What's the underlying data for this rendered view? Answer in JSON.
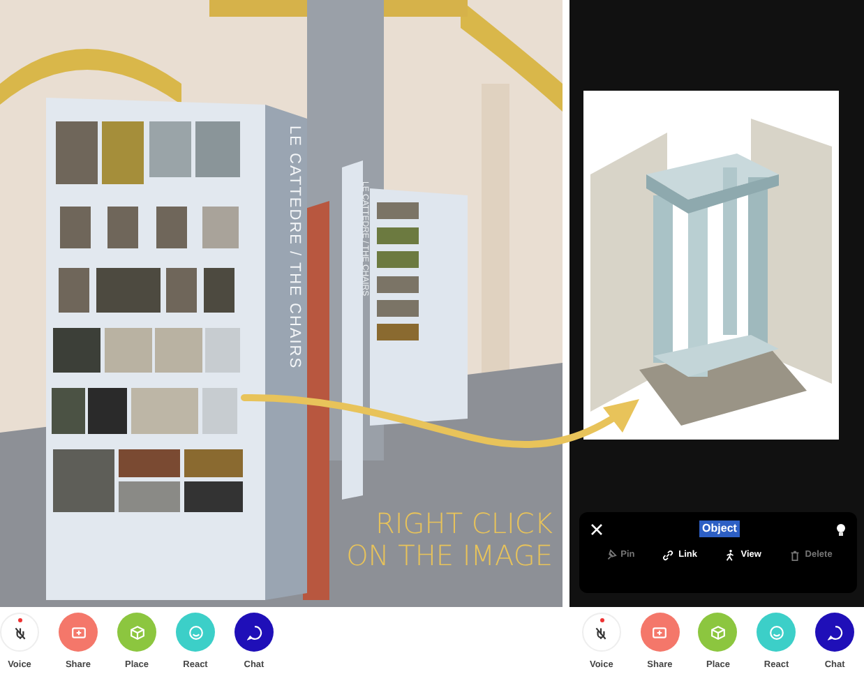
{
  "scene": {
    "panel_titles": [
      "LE CATTEDRE / THE CHAIRS",
      "LE CATTEDRE / THE CHAIRS"
    ]
  },
  "annotation": {
    "text": "RIGHT CLICK ON THE IMAGE"
  },
  "object_menu": {
    "title": "Object",
    "title_selected": true,
    "actions": [
      {
        "label": "Pin",
        "kind": "pin",
        "disabled": true
      },
      {
        "label": "Link",
        "kind": "link",
        "disabled": false
      },
      {
        "label": "View",
        "kind": "view",
        "disabled": false
      },
      {
        "label": "Delete",
        "kind": "delete",
        "disabled": true
      }
    ]
  },
  "toolbars": [
    {
      "buttons": [
        {
          "label": "Voice",
          "kind": "voice",
          "color": "#ffffff"
        },
        {
          "label": "Share",
          "kind": "share",
          "color": "#f4776a"
        },
        {
          "label": "Place",
          "kind": "place",
          "color": "#8cc63f"
        },
        {
          "label": "React",
          "kind": "react",
          "color": "#3ccfc8"
        },
        {
          "label": "Chat",
          "kind": "chat",
          "color": "#1f0fb8"
        }
      ]
    },
    {
      "buttons": [
        {
          "label": "Voice",
          "kind": "voice",
          "color": "#ffffff"
        },
        {
          "label": "Share",
          "kind": "share",
          "color": "#f4776a"
        },
        {
          "label": "Place",
          "kind": "place",
          "color": "#8cc63f"
        },
        {
          "label": "React",
          "kind": "react",
          "color": "#3ccfc8"
        },
        {
          "label": "Chat",
          "kind": "chat",
          "color": "#1f0fb8"
        }
      ]
    }
  ]
}
